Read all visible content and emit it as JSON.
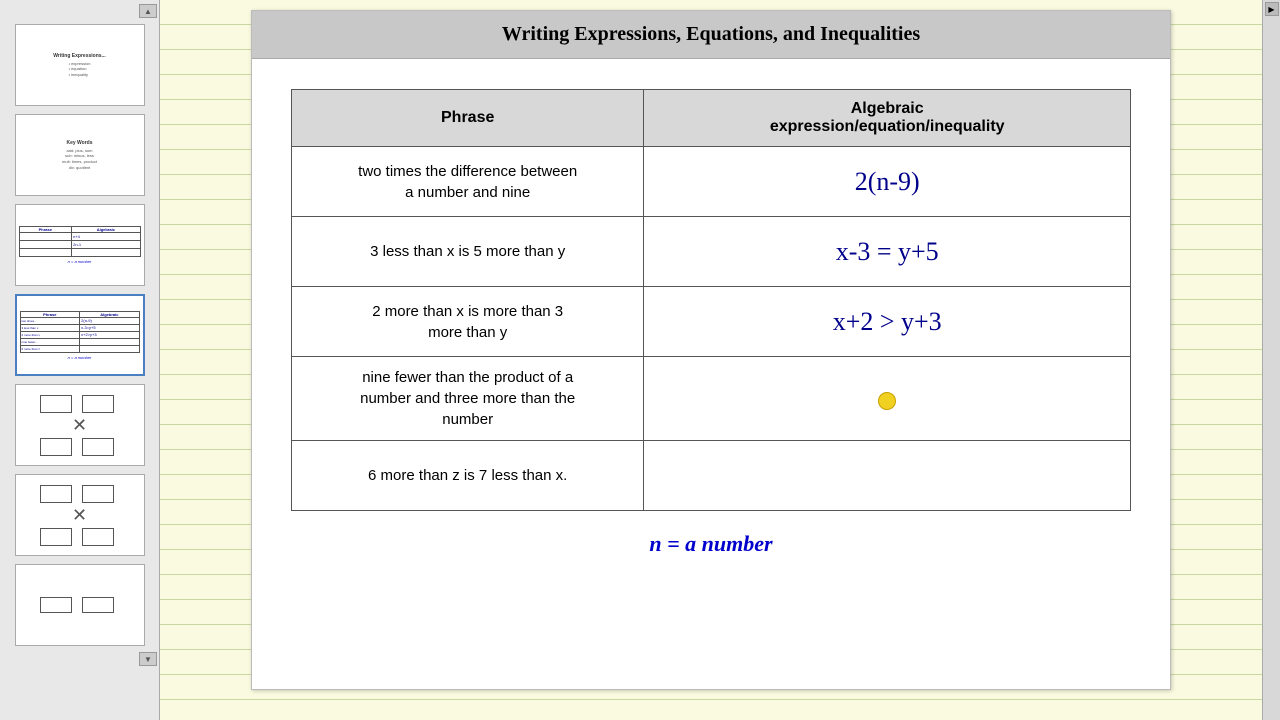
{
  "sidebar": {
    "scroll_up_label": "▲",
    "scroll_down_label": "▼",
    "slides": [
      {
        "id": 1,
        "active": false,
        "type": "text"
      },
      {
        "id": 2,
        "active": false,
        "type": "text"
      },
      {
        "id": 3,
        "active": false,
        "type": "table"
      },
      {
        "id": 4,
        "active": true,
        "type": "table"
      },
      {
        "id": 5,
        "active": false,
        "type": "boxes"
      },
      {
        "id": 6,
        "active": false,
        "type": "boxes"
      },
      {
        "id": 7,
        "active": false,
        "type": "boxes"
      }
    ]
  },
  "slide": {
    "title": "Writing Expressions, Equations, and Inequalities",
    "table": {
      "col_phrase": "Phrase",
      "col_algebraic": "Algebraic expression/equation/inequality",
      "rows": [
        {
          "phrase": "two times the difference between a number and nine",
          "algebraic": "2(n-9)"
        },
        {
          "phrase": "3 less than x is 5 more than y",
          "algebraic": "x-3 = y+5"
        },
        {
          "phrase": "2 more than x is more than 3 more than y",
          "algebraic": "x+2 > y+3"
        },
        {
          "phrase": "nine fewer than the product of a number and three more than the number",
          "algebraic": ""
        },
        {
          "phrase": "6 more than z is 7 less than x.",
          "algebraic": ""
        }
      ]
    },
    "legend": "n = a number"
  },
  "rightbar": {
    "scroll_label": "▶"
  }
}
